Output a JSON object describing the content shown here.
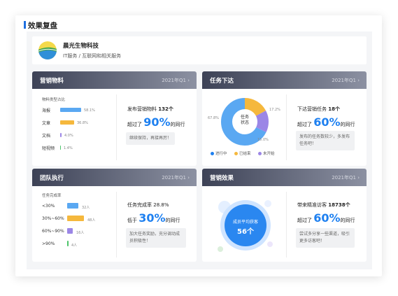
{
  "section_title": "效果复盘",
  "company": {
    "name": "晨光生物科技",
    "industry": "IT服务 / 互联网和相关服务"
  },
  "panels": {
    "marketing": {
      "title": "营销物料",
      "quarter": "2021年Q1",
      "chart_title": "物料类型占比",
      "items": [
        {
          "label": "海报",
          "value": "58.1%"
        },
        {
          "label": "文章",
          "value": "36.8%"
        },
        {
          "label": "文档",
          "value": "4.0%"
        },
        {
          "label": "短视频",
          "value": "1.4%"
        }
      ],
      "stat_prefix": "发布营销物料",
      "stat_value": "132个",
      "exceed_prefix": "超过了",
      "exceed_value": "90%",
      "exceed_suffix": "的同行",
      "note": "继续保持，再接再厉！"
    },
    "tasks": {
      "title": "任务下达",
      "quarter": "2021年Q1",
      "donut_center": "任务状态",
      "slices": [
        {
          "label": "进行中",
          "value": "67.8%",
          "color": "#5aa8f2"
        },
        {
          "label": "已结束",
          "value": "17.2%",
          "color": "#f5b83d"
        },
        {
          "label": "未开始",
          "value": "15.0%",
          "color": "#9b86e6"
        }
      ],
      "stat_prefix": "下达营销任务",
      "stat_value": "18个",
      "exceed_prefix": "超过了",
      "exceed_value": "60%",
      "exceed_suffix": "的同行",
      "note": "发布的任务数较少，多发布任务吧！"
    },
    "team": {
      "title": "团队执行",
      "quarter": "2021年Q1",
      "chart_title": "任务完成率",
      "items": [
        {
          "label": "<30%",
          "value": "32人"
        },
        {
          "label": "30%~60%",
          "value": "48人"
        },
        {
          "label": "60%~90%",
          "value": "16人"
        },
        {
          "label": ">90%",
          "value": "4人"
        }
      ],
      "stat_prefix": "任务完成率",
      "stat_value": "28.8%",
      "exceed_prefix": "低于",
      "exceed_value": "30%",
      "exceed_suffix": "的同行",
      "note": "加大任务奖励，充分调动成员积极性！"
    },
    "effect": {
      "title": "营销效果",
      "quarter": "2021年Q1",
      "circle_label": "成员平均获客",
      "circle_value": "56个",
      "stat_prefix": "带来精准访客",
      "stat_value": "18738个",
      "exceed_prefix": "超过了",
      "exceed_value": "60%",
      "exceed_suffix": "的同行",
      "note": "尝试多分享一些渠道，吸引更多访客吧！"
    }
  },
  "colors": {
    "accent": "#1e80f0",
    "header_dark": "#3d4256"
  }
}
